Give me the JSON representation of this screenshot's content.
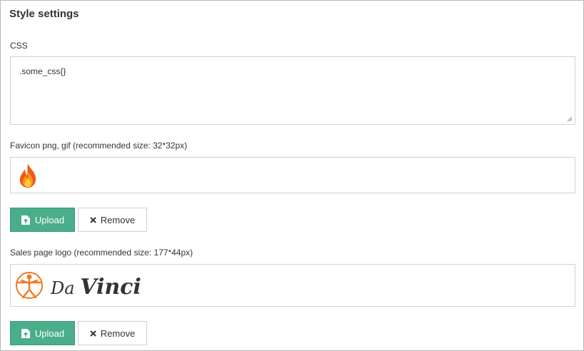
{
  "section": {
    "title": "Style settings"
  },
  "css_field": {
    "label": "CSS",
    "value": ".some_css{}"
  },
  "favicon": {
    "label": "Favicon png, gif (recommended size: 32*32px)",
    "upload_label": "Upload",
    "remove_label": "Remove"
  },
  "logo": {
    "label": "Sales page logo (recommended size: 177*44px)",
    "text_da": "Da",
    "text_vinci": "Vinci",
    "upload_label": "Upload",
    "remove_label": "Remove"
  },
  "colors": {
    "accent": "#4aae8a",
    "logo_orange": "#f07a22",
    "border": "#d2d2d2"
  },
  "icons": [
    "flame-icon",
    "upload-icon",
    "close-icon",
    "vitruvian-man-icon",
    "resize-grip-icon"
  ]
}
